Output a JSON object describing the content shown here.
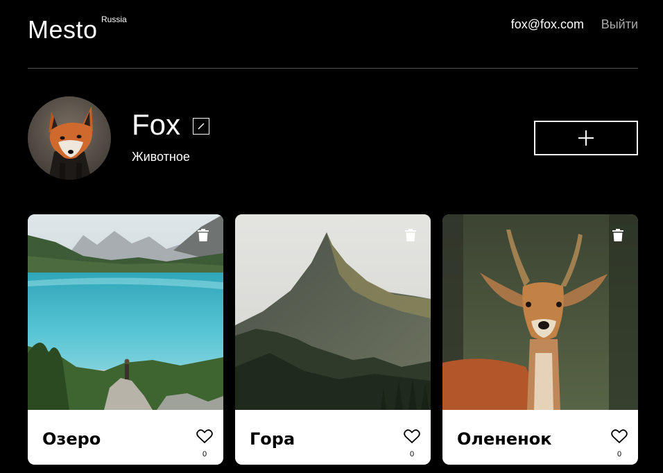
{
  "header": {
    "logo": "Mesto",
    "logo_sup": "Russia",
    "email": "fox@fox.com",
    "logout": "Выйти"
  },
  "profile": {
    "name": "Fox",
    "about": "Животное",
    "avatar_icon": "fox-avatar-photo",
    "edit_icon": "pencil-icon",
    "add_icon": "plus-icon"
  },
  "cards": [
    {
      "title": "Озеро",
      "likes": "0",
      "image_icon": "lake-photo"
    },
    {
      "title": "Гора",
      "likes": "0",
      "image_icon": "mountain-photo"
    },
    {
      "title": "Олененок",
      "likes": "0",
      "image_icon": "deer-photo"
    }
  ]
}
